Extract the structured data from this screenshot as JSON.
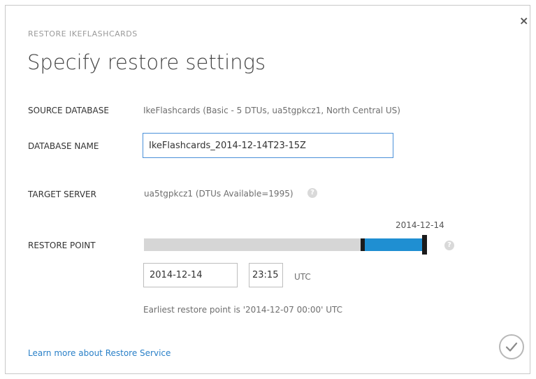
{
  "dialog": {
    "kicker": "RESTORE IKEFLASHCARDS",
    "title": "Specify restore settings",
    "close_label": "×"
  },
  "source_database": {
    "label": "SOURCE DATABASE",
    "value": "IkeFlashcards (Basic - 5 DTUs, ua5tgpkcz1, North Central US)"
  },
  "database_name": {
    "label": "DATABASE NAME",
    "value": "IkeFlashcards_2014-12-14T23-15Z"
  },
  "target_server": {
    "label": "TARGET SERVER",
    "value": "ua5tgpkcz1 (DTUs Available=1995)"
  },
  "restore_point": {
    "label": "RESTORE POINT",
    "slider_label": "2014-12-14",
    "slider_position": 0.99,
    "date_value": "2014-12-14",
    "time_value": "23:15",
    "timezone": "UTC",
    "earliest_note": "Earliest restore point is '2014-12-07 00:00' UTC"
  },
  "footer": {
    "learn_more": "Learn more about Restore Service"
  },
  "icons": {
    "help": "?",
    "ok": "checkmark-icon"
  },
  "colors": {
    "accent": "#1f8fd2",
    "link": "#2a80c8",
    "track": "#d6d6d6",
    "focus_border": "#4a90d9"
  }
}
